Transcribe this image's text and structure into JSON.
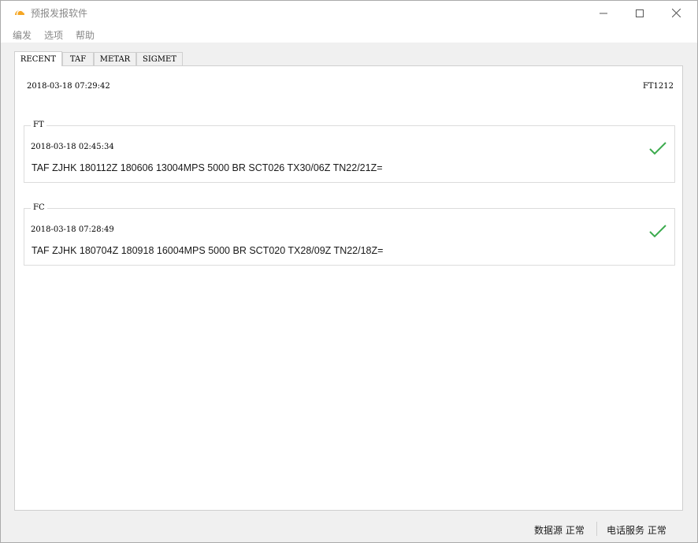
{
  "window": {
    "title": "预报发报软件",
    "icon": "sun-horizon-icon",
    "controls": [
      "minimize-icon",
      "maximize-icon",
      "close-icon"
    ]
  },
  "menu": {
    "items": [
      "编发",
      "选项",
      "帮助"
    ]
  },
  "tabs": {
    "items": [
      "RECENT",
      "TAF",
      "METAR",
      "SIGMET"
    ],
    "active": "RECENT"
  },
  "recent": {
    "timestamp": "2018-03-18 07:29:42",
    "code": "FT1212",
    "groups": [
      {
        "label": "FT",
        "time": "2018-03-18 02:45:34",
        "message": "TAF ZJHK 180112Z 180606 13004MPS 5000 BR SCT026 TX30/06Z TN22/21Z=",
        "status_icon": "checkmark-icon"
      },
      {
        "label": "FC",
        "time": "2018-03-18 07:28:49",
        "message": "TAF ZJHK 180704Z 180918 16004MPS 5000 BR SCT020 TX28/09Z TN22/18Z=",
        "status_icon": "checkmark-icon"
      }
    ]
  },
  "status": {
    "data_source": "数据源  正常",
    "phone_service": "电话服务  正常"
  },
  "colors": {
    "check": "#3cab4e",
    "icon_orange": "#f5a623"
  }
}
